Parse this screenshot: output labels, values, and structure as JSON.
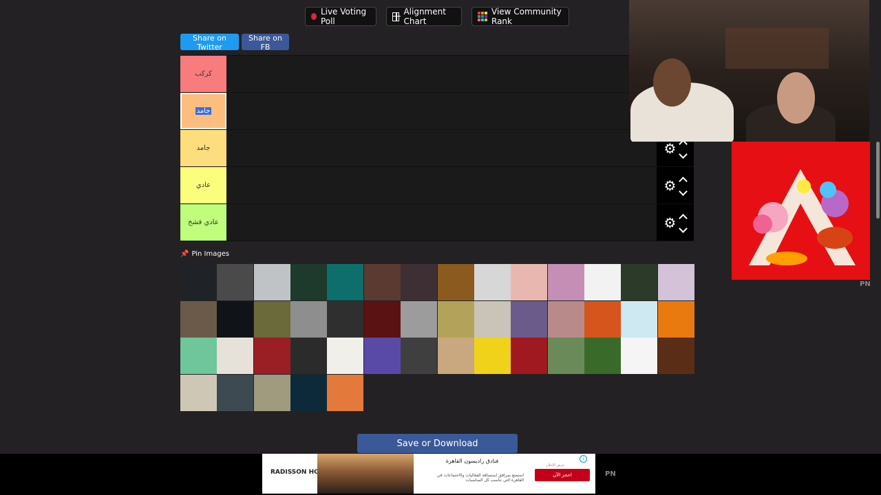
{
  "toolbar": {
    "live_voting": "Live Voting Poll",
    "alignment_chart": "Alignment Chart",
    "community_rank": "View Community Rank"
  },
  "share": {
    "twitter": "Share on Twitter",
    "facebook": "Share on FB"
  },
  "tiers": [
    {
      "label": "كركب",
      "color": "#f87b7e"
    },
    {
      "label": "جامد",
      "color": "#fbbe7e"
    },
    {
      "label": "جامد",
      "color": "#fcde7e"
    },
    {
      "label": "عادي",
      "color": "#fbfe7d"
    },
    {
      "label": "عادي فشخ",
      "color": "#bffd7b"
    }
  ],
  "pin_images_label": "Pin Images",
  "pool_images": [
    {
      "name": "artist-01",
      "bg": "#1f2226"
    },
    {
      "name": "artist-02",
      "bg": "#4a4a4a"
    },
    {
      "name": "artist-03",
      "bg": "#bfc3c6"
    },
    {
      "name": "artist-04",
      "bg": "#1d3a2c"
    },
    {
      "name": "artist-05",
      "bg": "#0e6e6b"
    },
    {
      "name": "artist-06",
      "bg": "#5b3a32"
    },
    {
      "name": "artist-07",
      "bg": "#3d2f33"
    },
    {
      "name": "artist-08",
      "bg": "#8a5a1f"
    },
    {
      "name": "artist-09",
      "bg": "#d7d7d7"
    },
    {
      "name": "artist-10",
      "bg": "#e8b8b0"
    },
    {
      "name": "artist-11",
      "bg": "#c58fb5"
    },
    {
      "name": "artist-12",
      "bg": "#f2f2f2"
    },
    {
      "name": "artist-13",
      "bg": "#2c3a2a"
    },
    {
      "name": "artist-14",
      "bg": "#d4c2d9"
    },
    {
      "name": "artist-15",
      "bg": "#6b5a4a"
    },
    {
      "name": "artist-16",
      "bg": "#101418"
    },
    {
      "name": "artist-17",
      "bg": "#6a6a3a"
    },
    {
      "name": "artist-18",
      "bg": "#8e8e8e"
    },
    {
      "name": "artist-19",
      "bg": "#2f2f2f"
    },
    {
      "name": "artist-20",
      "bg": "#5a1212"
    },
    {
      "name": "artist-21",
      "bg": "#9c9c9c"
    },
    {
      "name": "artist-22",
      "bg": "#b3a35a"
    },
    {
      "name": "artist-23",
      "bg": "#c9c3b8"
    },
    {
      "name": "artist-24",
      "bg": "#6b5b8b"
    },
    {
      "name": "artist-25",
      "bg": "#b88a8a"
    },
    {
      "name": "artist-26",
      "bg": "#d6551c"
    },
    {
      "name": "artist-27",
      "bg": "#cfe9f2"
    },
    {
      "name": "artist-28",
      "bg": "#e87a10"
    },
    {
      "name": "artist-29",
      "bg": "#6fc69a"
    },
    {
      "name": "artist-30",
      "bg": "#e6e2da"
    },
    {
      "name": "artist-31",
      "bg": "#9a1f25"
    },
    {
      "name": "artist-32",
      "bg": "#2b2b2b"
    },
    {
      "name": "artist-33",
      "bg": "#f1efe9"
    },
    {
      "name": "artist-34",
      "bg": "#5a4aa8"
    },
    {
      "name": "artist-35",
      "bg": "#3f3f3f"
    },
    {
      "name": "artist-36",
      "bg": "#c9a87f"
    },
    {
      "name": "artist-37",
      "bg": "#f0d21a"
    },
    {
      "name": "artist-38",
      "bg": "#a01820"
    },
    {
      "name": "artist-39",
      "bg": "#6a8a5a"
    },
    {
      "name": "artist-40",
      "bg": "#3a6a2a"
    },
    {
      "name": "artist-41",
      "bg": "#f5f5f5"
    },
    {
      "name": "artist-42",
      "bg": "#5a2e16"
    },
    {
      "name": "artist-43",
      "bg": "#cfc7b6"
    },
    {
      "name": "artist-44",
      "bg": "#3e4a52"
    },
    {
      "name": "artist-45",
      "bg": "#a09a7e"
    },
    {
      "name": "artist-46",
      "bg": "#0d2a3a"
    },
    {
      "name": "artist-47",
      "bg": "#e3793a"
    }
  ],
  "save_button": "Save or Download",
  "ad": {
    "brand": "RADISSON HOTELS",
    "title": "فنادق راديسون القاهرة",
    "body": "استمتع بمرافق استضافة الفعاليات والاجتماعات في القاهرة التي تناسب كل المناسبات",
    "cta": "احجز الآن",
    "small": "عرض الإعلان"
  },
  "pn_label": "PN"
}
